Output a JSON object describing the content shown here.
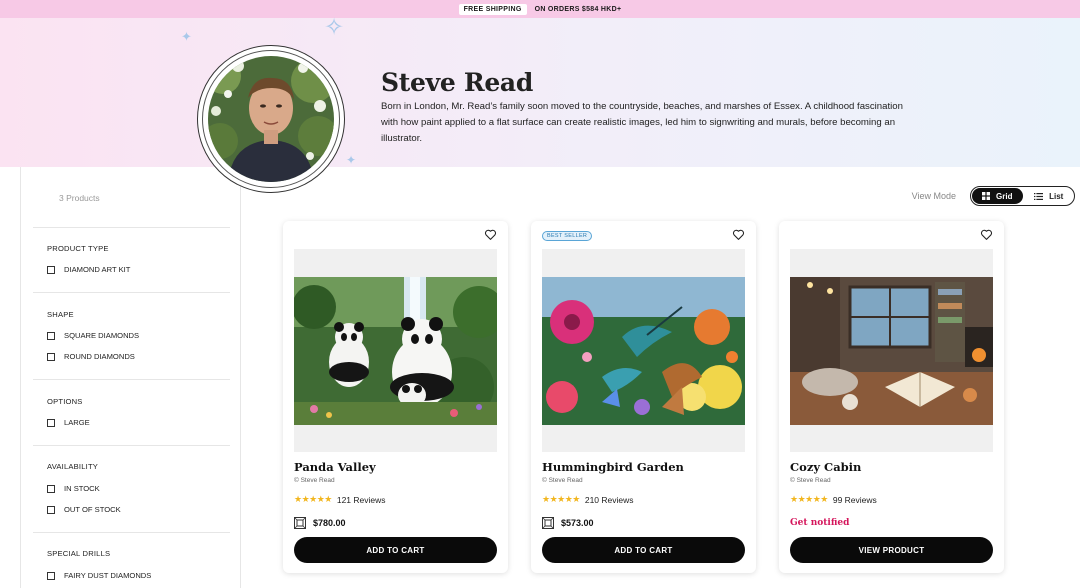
{
  "announcement": {
    "label": "FREE SHIPPING",
    "text": "ON ORDERS $584 HKD+"
  },
  "artist": {
    "name": "Steve Read",
    "bio": "Born in London, Mr. Read’s family soon moved to the countryside, beaches, and marshes of Essex. A childhood fascination with how paint applied to a flat surface can create realistic images, led him to signwriting and murals, before becoming an illustrator."
  },
  "sidebar": {
    "product_count": "3 Products",
    "groups": [
      {
        "title": "PRODUCT TYPE",
        "options": [
          "DIAMOND ART KIT"
        ]
      },
      {
        "title": "SHAPE",
        "options": [
          "SQUARE DIAMONDS",
          "ROUND DIAMONDS"
        ]
      },
      {
        "title": "OPTIONS",
        "options": [
          "LARGE"
        ]
      },
      {
        "title": "AVAILABILITY",
        "options": [
          "IN STOCK",
          "OUT OF STOCK"
        ]
      },
      {
        "title": "SPECIAL DRILLS",
        "options": [
          "FAIRY DUST DIAMONDS"
        ]
      }
    ]
  },
  "view_mode": {
    "label": "View Mode",
    "grid": "Grid",
    "list": "List",
    "selected": "Grid"
  },
  "products": [
    {
      "title": "Panda Valley",
      "artist": "© Steve Read",
      "stars": "★★★★★",
      "reviews": "121 Reviews",
      "price": "$780.00",
      "button": "ADD TO CART",
      "badge": ""
    },
    {
      "title": "Hummingbird Garden",
      "artist": "© Steve Read",
      "stars": "★★★★★",
      "reviews": "210 Reviews",
      "price": "$573.00",
      "button": "ADD TO CART",
      "badge": "BEST SELLER"
    },
    {
      "title": "Cozy Cabin",
      "artist": "© Steve Read",
      "stars": "★★★★★",
      "reviews": "99 Reviews",
      "notify": "Get notified",
      "button": "VIEW PRODUCT",
      "badge": ""
    }
  ],
  "colors": {
    "banner": "#f7c9e6",
    "accent_notify": "#d4145a",
    "star": "#f2b61f",
    "button": "#0a0a0a"
  }
}
